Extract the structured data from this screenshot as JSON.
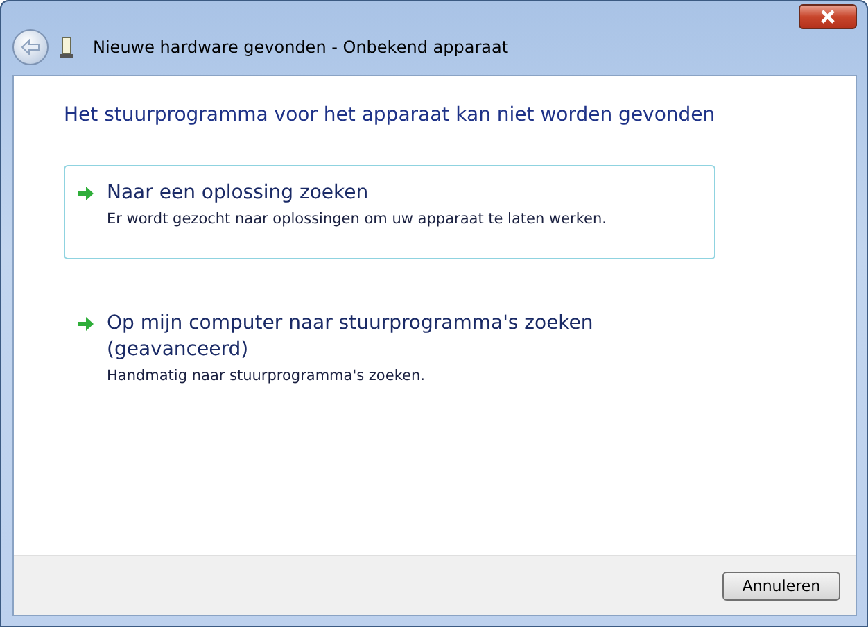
{
  "window": {
    "title": "Nieuwe hardware gevonden - Onbekend apparaat"
  },
  "heading": "Het stuurprogramma voor het apparaat kan niet worden gevonden",
  "options": [
    {
      "title": "Naar een oplossing zoeken",
      "description": "Er wordt gezocht naar oplossingen om uw apparaat te laten werken.",
      "highlighted": true
    },
    {
      "title": "Op mijn computer naar stuurprogramma's zoeken (geavanceerd)",
      "description": "Handmatig naar stuurprogramma's zoeken.",
      "highlighted": false
    }
  ],
  "buttons": [
    "Annuleren"
  ]
}
